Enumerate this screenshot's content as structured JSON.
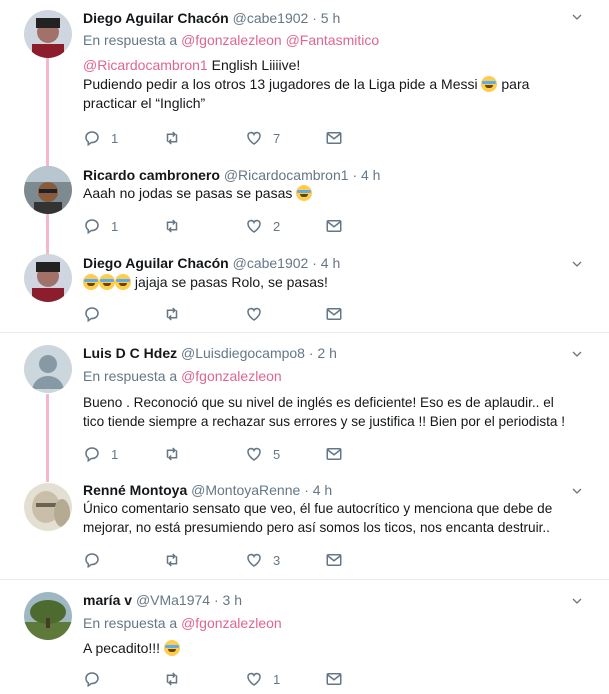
{
  "tweets": [
    {
      "name": "Diego Aguilar Chacón",
      "handle": "@cabe1902",
      "time": "· 5 h",
      "reply_prefix": "En respuesta a",
      "reply_to": [
        "@fgonzalezleon",
        "@Fantasmitico"
      ],
      "mention": "@Ricardocambron1",
      "line1_rest": " English Liiiive!",
      "line2a": "Pudiendo pedir a los otros 13 jugadores de la Liga pide a Messi",
      "line2b": " para",
      "line3": "practicar el “Inglich”",
      "counts": {
        "reply": "1",
        "retweet": "",
        "like": "7"
      }
    },
    {
      "name": "Ricardo cambronero",
      "handle": "@Ricardocambron1",
      "time": "· 4 h",
      "text": "Aaah no jodas se pasas se pasas",
      "counts": {
        "reply": "1",
        "retweet": "",
        "like": "2"
      }
    },
    {
      "name": "Diego Aguilar Chacón",
      "handle": "@cabe1902",
      "time": "· 4 h",
      "text": " jajaja se pasas Rolo, se pasas!",
      "counts": {
        "reply": "",
        "retweet": "",
        "like": ""
      }
    },
    {
      "name": "Luis D C Hdez",
      "handle": "@Luisdiegocampo8",
      "time": "· 2 h",
      "reply_prefix": "En respuesta a",
      "reply_to": [
        "@fgonzalezleon"
      ],
      "line1": "Bueno . Reconoció que su nivel de inglés es deficiente!  Eso es de aplaudir.. el",
      "line2": "tico tiende siempre a rechazar sus errores y se justifica !! Bien por el periodista !",
      "counts": {
        "reply": "1",
        "retweet": "",
        "like": "5"
      }
    },
    {
      "name": "Renné Montoya",
      "handle": "@MontoyaRenne",
      "time": "· 4 h",
      "line1": "Único comentario sensato que veo, él fue autocrítico y menciona que debe de",
      "line2": "mejorar, no está presumiendo pero así somos los ticos, nos encanta destruir..",
      "counts": {
        "reply": "",
        "retweet": "",
        "like": "3"
      }
    },
    {
      "name": "maría v",
      "handle": "@VMa1974",
      "time": "· 3 h",
      "reply_prefix": "En respuesta a",
      "reply_to": [
        "@fgonzalezleon"
      ],
      "text": "A pecadito!!!",
      "counts": {
        "reply": "",
        "retweet": "",
        "like": "1"
      }
    }
  ],
  "colors": {
    "mention": "#e0658f",
    "thread_line": "#f4b8cc",
    "muted": "#657786"
  },
  "icons": [
    "reply-icon",
    "retweet-icon",
    "like-icon",
    "dm-icon",
    "chevron-down-icon"
  ]
}
